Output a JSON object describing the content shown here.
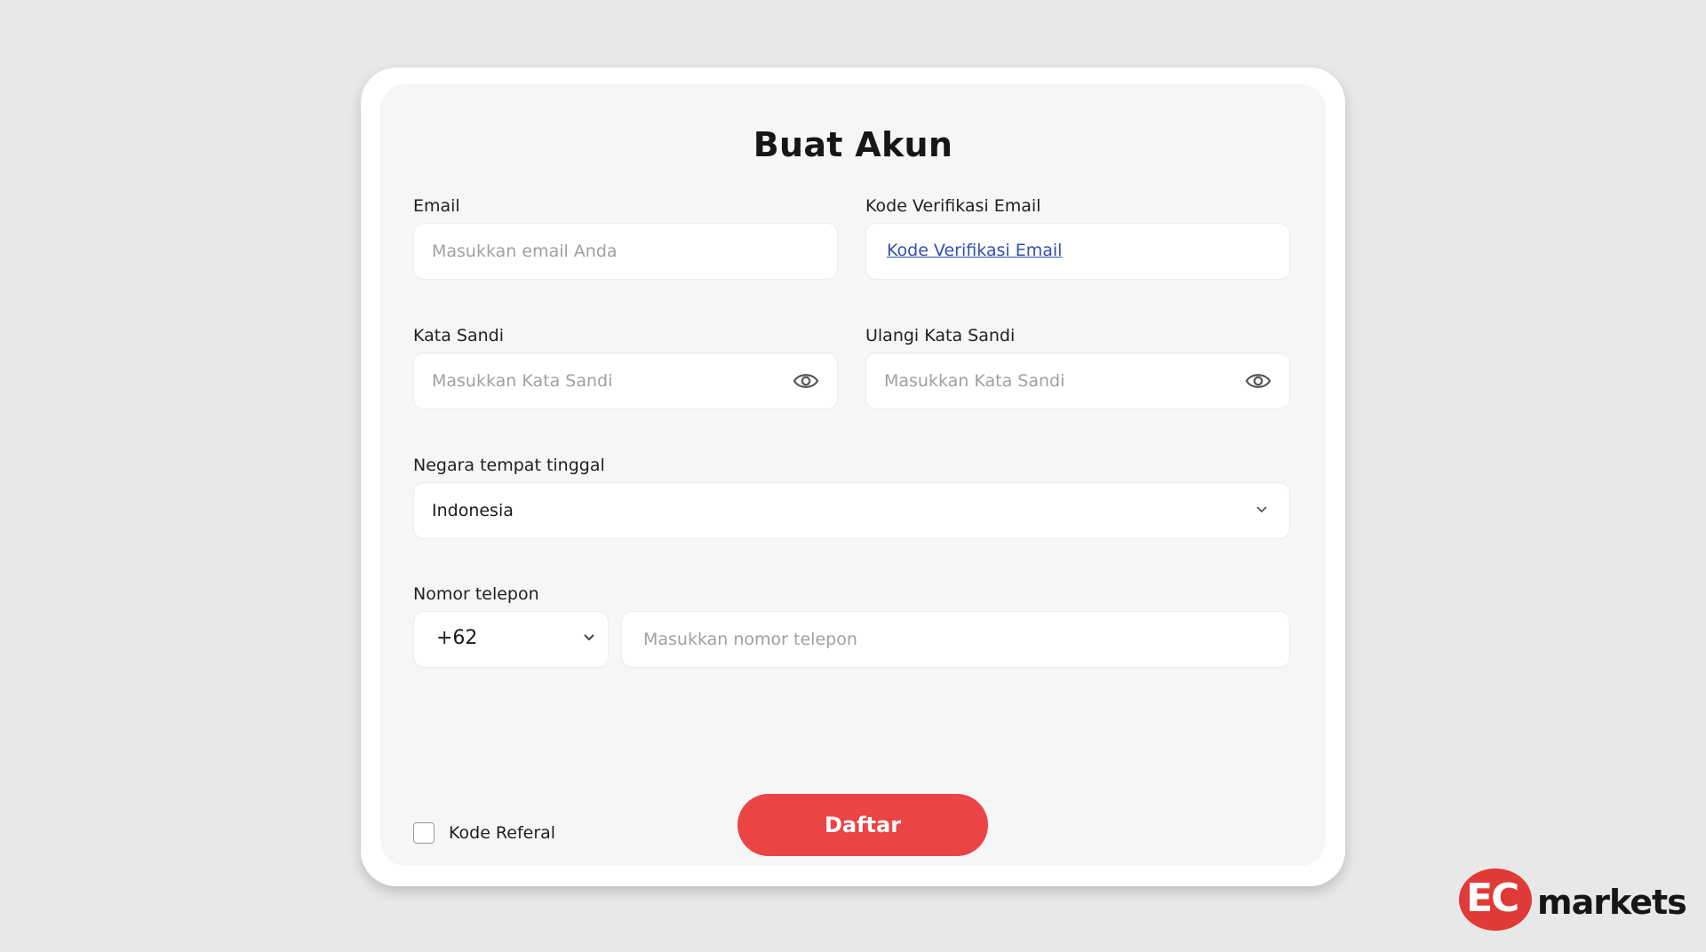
{
  "form": {
    "title": "Buat Akun",
    "email": {
      "label": "Email",
      "placeholder": "Masukkan email Anda",
      "value": ""
    },
    "verification": {
      "label": "Kode Verifikasi Email",
      "link_text": "Kode Verifikasi Email"
    },
    "password": {
      "label": "Kata Sandi",
      "placeholder": "Masukkan Kata Sandi",
      "value": ""
    },
    "confirm_password": {
      "label": "Ulangi Kata Sandi",
      "placeholder": "Masukkan Kata Sandi",
      "value": ""
    },
    "country": {
      "label": "Negara tempat tinggal",
      "selected": "Indonesia"
    },
    "phone": {
      "label": "Nomor telepon",
      "country_code": "+62",
      "placeholder": "Masukkan nomor telepon",
      "value": ""
    },
    "referral": {
      "label": "Kode Referal",
      "checked": false
    },
    "submit_label": "Daftar"
  },
  "brand": {
    "logo_mark": "EC",
    "logo_text": "markets",
    "accent_color": "#ea4444",
    "logo_color": "#e03a36",
    "link_color": "#2f4fb4"
  },
  "icons": {
    "password_toggle": "eye-icon",
    "dropdown": "chevron-down-icon"
  }
}
